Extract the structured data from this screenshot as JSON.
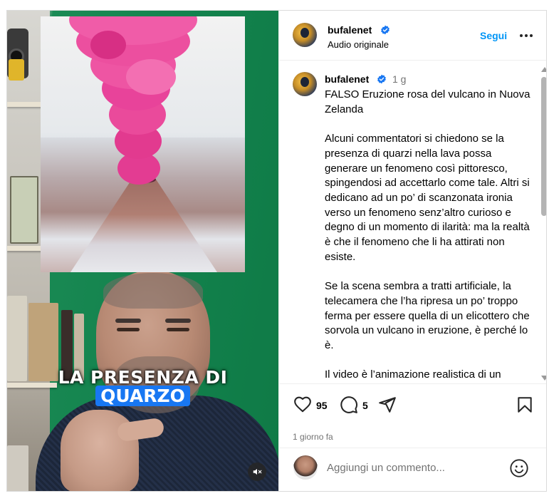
{
  "post": {
    "author": "bufalenet",
    "header_subtitle": "Audio originale",
    "follow_label": "Segui",
    "caption_time": "1 g",
    "caption_paragraphs": [
      "FALSO Eruzione rosa del vulcano in Nuova Zelanda",
      "Alcuni commentatori si chiedono se la presenza di quarzi nella lava possa generare un fenomeno così pittoresco, spingendosi ad accettarlo come tale. Altri si dedicano ad un po’ di scanzonata ironia verso un fenomeno senz’altro curioso e degno di un momento di ilarità: ma la realtà è che il fenomeno che li ha attirati non esiste.",
      "Se la scena sembra a tratti artificiale, la telecamera che l’ha ripresa un po’ troppo ferma per essere quella di un elicottero che sorvola un vulcano in eruzione, è perché lo è.",
      "Il video è l’animazione realistica di un artista di Praga"
    ],
    "like_count": "95",
    "comment_count": "5",
    "date_label": "1 giorno fa"
  },
  "video": {
    "caption_line1": "LA PRESENZA DI",
    "caption_line2": "QUARZO",
    "muted": true
  },
  "add_comment": {
    "placeholder": "Aggiungi un commento..."
  },
  "icons": {
    "verified": "verified-badge-icon",
    "more": "more-options-icon",
    "like": "heart-icon",
    "comment": "comment-bubble-icon",
    "share": "paper-plane-icon",
    "save": "bookmark-icon",
    "emoji": "emoji-icon",
    "mute": "speaker-muted-icon"
  },
  "colors": {
    "accent_blue": "#0095f6",
    "verified_blue": "#1877f2",
    "secondary_text": "#737373",
    "caption_highlight": "#1877f2",
    "plume_pink": "#e33c92"
  }
}
